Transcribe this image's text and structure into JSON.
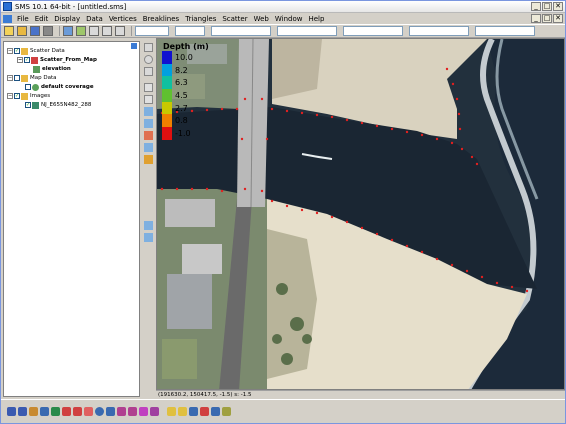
{
  "window": {
    "title": "SMS 10.1 64-bit - [untitled.sms]"
  },
  "menu": [
    "File",
    "Edit",
    "Display",
    "Data",
    "Vertices",
    "Breaklines",
    "Triangles",
    "Scatter",
    "Web",
    "Window",
    "Help"
  ],
  "titlebar_buttons": [
    "_",
    "□",
    "✕"
  ],
  "tree": {
    "items": [
      {
        "label": "Scatter Data",
        "icon": "folder-icon",
        "bold": false
      },
      {
        "label": "Scatter_From_Map",
        "icon": "scatter-icon",
        "bold": true
      },
      {
        "label": "elevation",
        "icon": "dataset-icon",
        "bold": true
      },
      {
        "label": "Map Data",
        "icon": "folder-icon",
        "bold": false
      },
      {
        "label": "default coverage",
        "icon": "coverage-icon",
        "bold": true
      },
      {
        "label": "Images",
        "icon": "folder-icon",
        "bold": false
      },
      {
        "label": "NJ_E655N482_288",
        "icon": "image-icon",
        "bold": false
      }
    ]
  },
  "legend": {
    "title": "Depth (m)",
    "entries": [
      {
        "value": "10.0",
        "color": "#1010d0"
      },
      {
        "value": "8.2",
        "color": "#00a0e0"
      },
      {
        "value": "6.3",
        "color": "#10c0a0"
      },
      {
        "value": "4.5",
        "color": "#60c030"
      },
      {
        "value": "2.7",
        "color": "#c8c800"
      },
      {
        "value": "0.8",
        "color": "#f08000"
      },
      {
        "value": "-1.0",
        "color": "#e01010"
      }
    ]
  },
  "status": {
    "coords": "(191630.2, 150417.5, -1.5) s: -1.5"
  },
  "colors": {
    "water": "#1b2836",
    "sand": "#e8e0cc",
    "scatter_point": "#e02020",
    "bridge": "#b9b9b9"
  }
}
